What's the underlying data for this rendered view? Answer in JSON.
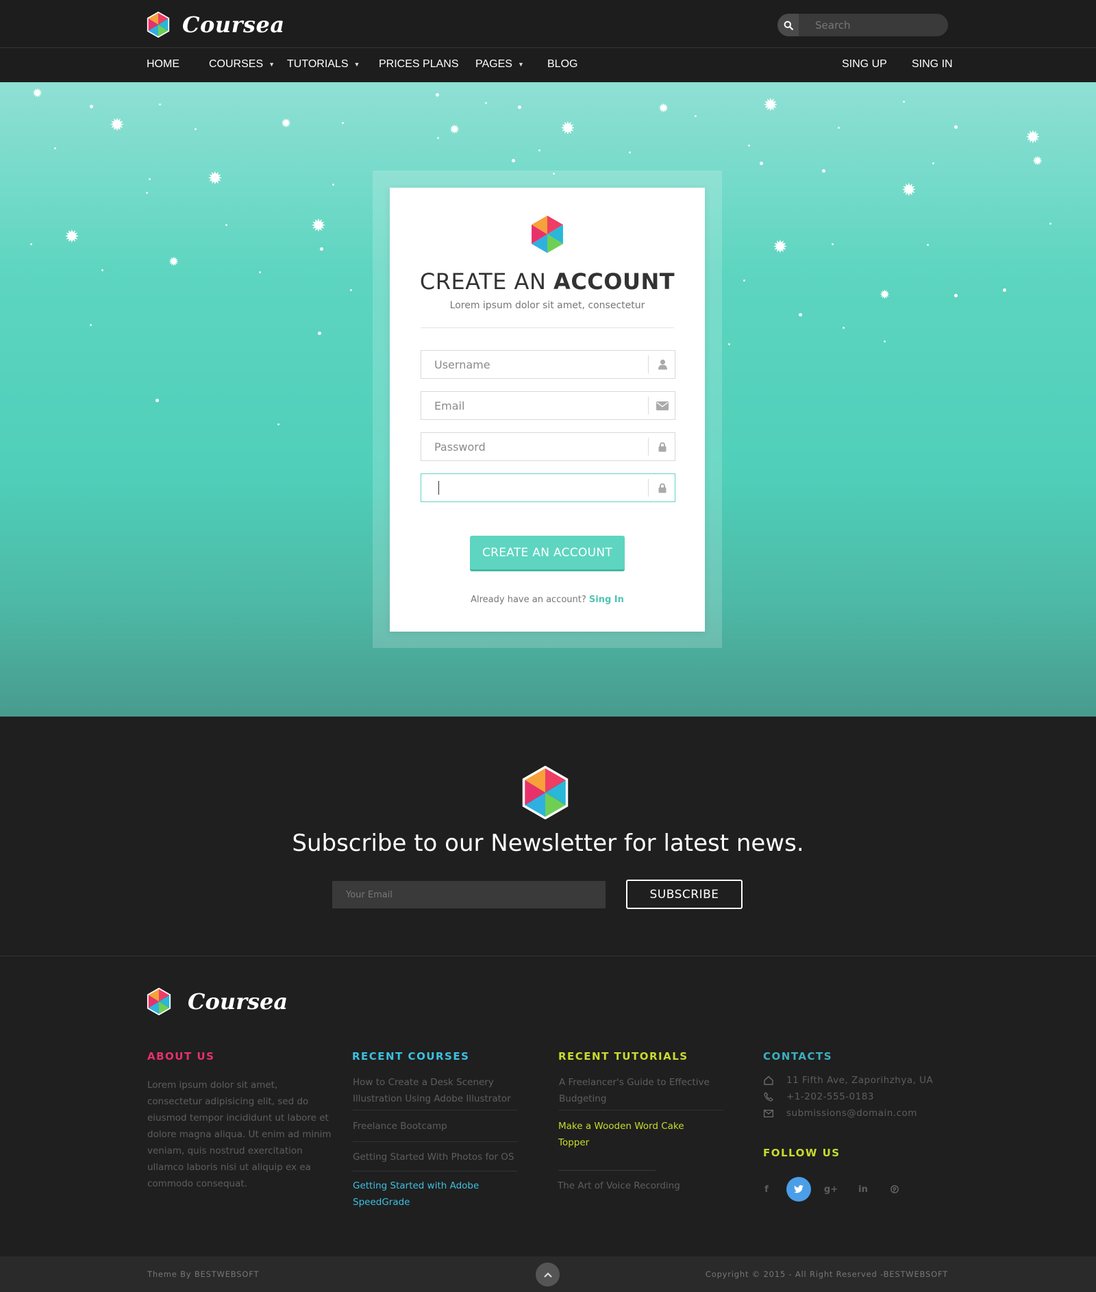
{
  "header": {
    "brand": "Coursea",
    "search": {
      "placeholder": "Search"
    }
  },
  "nav": {
    "items": [
      {
        "label": "HOME"
      },
      {
        "label": "COURSES"
      },
      {
        "label": "TUTORIALS"
      },
      {
        "label": "PRICES PLANS"
      },
      {
        "label": "PAGES"
      },
      {
        "label": "BLOG"
      }
    ],
    "sign_up": "SING UP",
    "sign_in": "SING IN"
  },
  "signup_form": {
    "title_light": "CREATE AN",
    "title_bold": "ACCOUNT",
    "subtitle": "Lorem ipsum dolor sit amet, consectetur",
    "fields": {
      "username": {
        "placeholder": "Username",
        "icon": "user-icon"
      },
      "email": {
        "placeholder": "Email",
        "icon": "envelope-icon"
      },
      "password": {
        "placeholder": "Password",
        "icon": "lock-icon"
      },
      "confirm_password": {
        "placeholder": "",
        "icon": "lock-icon",
        "focused": true
      }
    },
    "submit_label": "CREATE AN ACCOUNT",
    "already_text": "Already have an account?",
    "signin_link": "Sing In"
  },
  "newsletter": {
    "title": "Subscribe to our Newsletter for latest news.",
    "email_placeholder": "Your Email",
    "button": "SUBSCRIBE"
  },
  "footer": {
    "brand": "Coursea",
    "about": {
      "heading": "ABOUT US",
      "text": "Lorem ipsum dolor sit amet, consectetur adipisicing elit, sed do eiusmod tempor incididunt ut labore et dolore magna aliqua. Ut enim ad minim veniam, quis nostrud exercitation ullamco laboris nisi ut aliquip ex ea commodo consequat."
    },
    "recent_courses": {
      "heading": "RECENT  COURSES",
      "items": [
        "How to Create a Desk Scenery Illustration Using Adobe Illustrator",
        "Freelance Bootcamp",
        "Getting Started With Photos for OS",
        "Getting Started with Adobe SpeedGrade"
      ]
    },
    "recent_tutorials": {
      "heading": "RECENT  TUTORIALS",
      "items": [
        "A Freelancer's Guide to Effective Budgeting",
        "Make a Wooden Word Cake Topper",
        "The Art of Voice Recording"
      ]
    },
    "contacts": {
      "heading": "CONTACTS",
      "address": "11 Fifth Ave,  Zaporihzhya, UA",
      "phone": "+1-202-555-0183",
      "email": "submissions@domain.com"
    },
    "follow": {
      "heading": "FOLLOW US",
      "networks": [
        {
          "name": "facebook-icon",
          "glyph": "f"
        },
        {
          "name": "twitter-icon",
          "glyph": "t"
        },
        {
          "name": "google-plus-icon",
          "glyph": "g+"
        },
        {
          "name": "linkedin-icon",
          "glyph": "in"
        },
        {
          "name": "pinterest-icon",
          "glyph": "p"
        }
      ]
    },
    "colors": {
      "about": "#e8306a",
      "courses": "#3cc0e0",
      "tutorials": "#c8dc2c",
      "contacts": "#3ab0c0",
      "follow": "#c8dc2c"
    }
  },
  "bottom": {
    "theme_by": "Theme By BESTWEBSOFT",
    "copyright": "Copyright © 2015 - All Right Reserved -BESTWEBSOFT"
  },
  "theme": {
    "accent": "#5ed5c0",
    "dark": "#1f1f1f"
  }
}
